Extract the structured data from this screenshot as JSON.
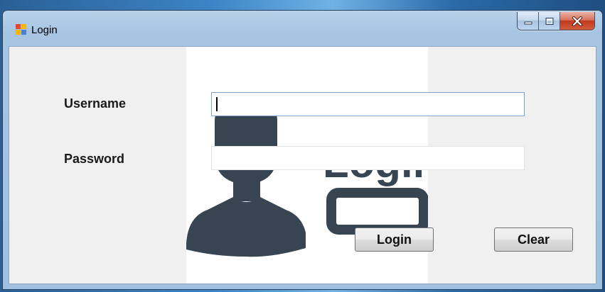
{
  "window": {
    "title": "Login",
    "controls": {
      "minimize": "minimize-icon",
      "maximize": "maximize-icon",
      "close": "close-icon"
    }
  },
  "form": {
    "username_label": "Username",
    "password_label": "Password",
    "username_value": "",
    "password_value": "",
    "login_button": "Login",
    "clear_button": "Clear"
  },
  "background_image": {
    "text": "Login",
    "color": "#374552"
  },
  "colors": {
    "titlebar": "#a7c5e3",
    "client": "#f0f0f0",
    "close_button": "#c8452b",
    "icon_dark": "#374552"
  }
}
